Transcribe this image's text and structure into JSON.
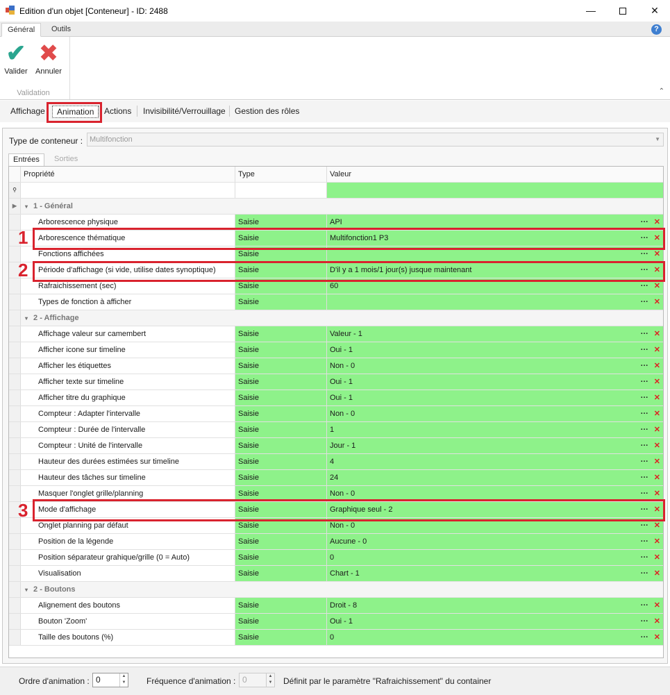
{
  "window": {
    "title": "Edition d'un objet [Conteneur] - ID: 2488",
    "minimize": "—",
    "close": "✕"
  },
  "ribbon": {
    "tabs": [
      "Général",
      "Outils"
    ],
    "validate_label": "Valider",
    "cancel_label": "Annuler",
    "group_label": "Validation",
    "help": "?"
  },
  "page_tabs": [
    "Affichage",
    "Animation",
    "Actions",
    "Invisibilité/Verrouillage",
    "Gestion des rôles"
  ],
  "container_type": {
    "label": "Type de conteneur :",
    "value": "Multifonction"
  },
  "sub_tabs": [
    "Entrées",
    "Sorties"
  ],
  "grid": {
    "headers": {
      "property": "Propriété",
      "type": "Type",
      "value": "Valeur"
    },
    "groups": [
      {
        "title": "1 - Général",
        "rows": [
          {
            "property": "Arborescence physique",
            "type": "Saisie",
            "value": "API"
          },
          {
            "property": "Arborescence thématique",
            "type": "Saisie",
            "value": "Multifonction1 P3"
          },
          {
            "property": "Fonctions affichées",
            "type": "Saisie",
            "value": ""
          },
          {
            "property": "Période d'affichage (si vide, utilise dates synoptique)",
            "type": "Saisie",
            "value": "D'il y a 1 mois/1 jour(s) jusque maintenant"
          },
          {
            "property": "Rafraichissement (sec)",
            "type": "Saisie",
            "value": "60"
          },
          {
            "property": "Types de fonction à afficher",
            "type": "Saisie",
            "value": ""
          }
        ]
      },
      {
        "title": "2 - Affichage",
        "rows": [
          {
            "property": "Affichage valeur sur camembert",
            "type": "Saisie",
            "value": "Valeur - 1"
          },
          {
            "property": "Afficher icone sur timeline",
            "type": "Saisie",
            "value": "Oui - 1"
          },
          {
            "property": "Afficher les étiquettes",
            "type": "Saisie",
            "value": "Non - 0"
          },
          {
            "property": "Afficher texte sur timeline",
            "type": "Saisie",
            "value": "Oui - 1"
          },
          {
            "property": "Afficher titre du graphique",
            "type": "Saisie",
            "value": "Oui - 1"
          },
          {
            "property": "Compteur : Adapter l'intervalle",
            "type": "Saisie",
            "value": "Non - 0"
          },
          {
            "property": "Compteur : Durée de l'intervalle",
            "type": "Saisie",
            "value": "1"
          },
          {
            "property": "Compteur : Unité de l'intervalle",
            "type": "Saisie",
            "value": "Jour - 1"
          },
          {
            "property": "Hauteur des durées estimées sur timeline",
            "type": "Saisie",
            "value": "4"
          },
          {
            "property": "Hauteur des tâches sur timeline",
            "type": "Saisie",
            "value": "24"
          },
          {
            "property": "Masquer l'onglet grille/planning",
            "type": "Saisie",
            "value": "Non - 0"
          },
          {
            "property": "Mode d'affichage",
            "type": "Saisie",
            "value": "Graphique seul - 2"
          },
          {
            "property": "Onglet planning par défaut",
            "type": "Saisie",
            "value": "Non - 0"
          },
          {
            "property": "Position de la légende",
            "type": "Saisie",
            "value": "Aucune - 0"
          },
          {
            "property": "Position séparateur grahique/grille (0 = Auto)",
            "type": "Saisie",
            "value": "0"
          },
          {
            "property": "Visualisation",
            "type": "Saisie",
            "value": "Chart - 1"
          }
        ]
      },
      {
        "title": "2 - Boutons",
        "rows": [
          {
            "property": "Alignement des boutons",
            "type": "Saisie",
            "value": "Droit - 8"
          },
          {
            "property": "Bouton 'Zoom'",
            "type": "Saisie",
            "value": "Oui - 1"
          },
          {
            "property": "Taille des boutons (%)",
            "type": "Saisie",
            "value": "0"
          }
        ]
      }
    ],
    "row_action_more": "···",
    "row_action_delete": "✕"
  },
  "annotations": [
    "1",
    "2",
    "3"
  ],
  "footer": {
    "order_label": "Ordre d'animation :",
    "order_value": "0",
    "frequency_label": "Fréquence d'animation :",
    "frequency_value": "0",
    "frequency_note": "Définit par le paramètre \"Rafraichissement\" du container"
  }
}
